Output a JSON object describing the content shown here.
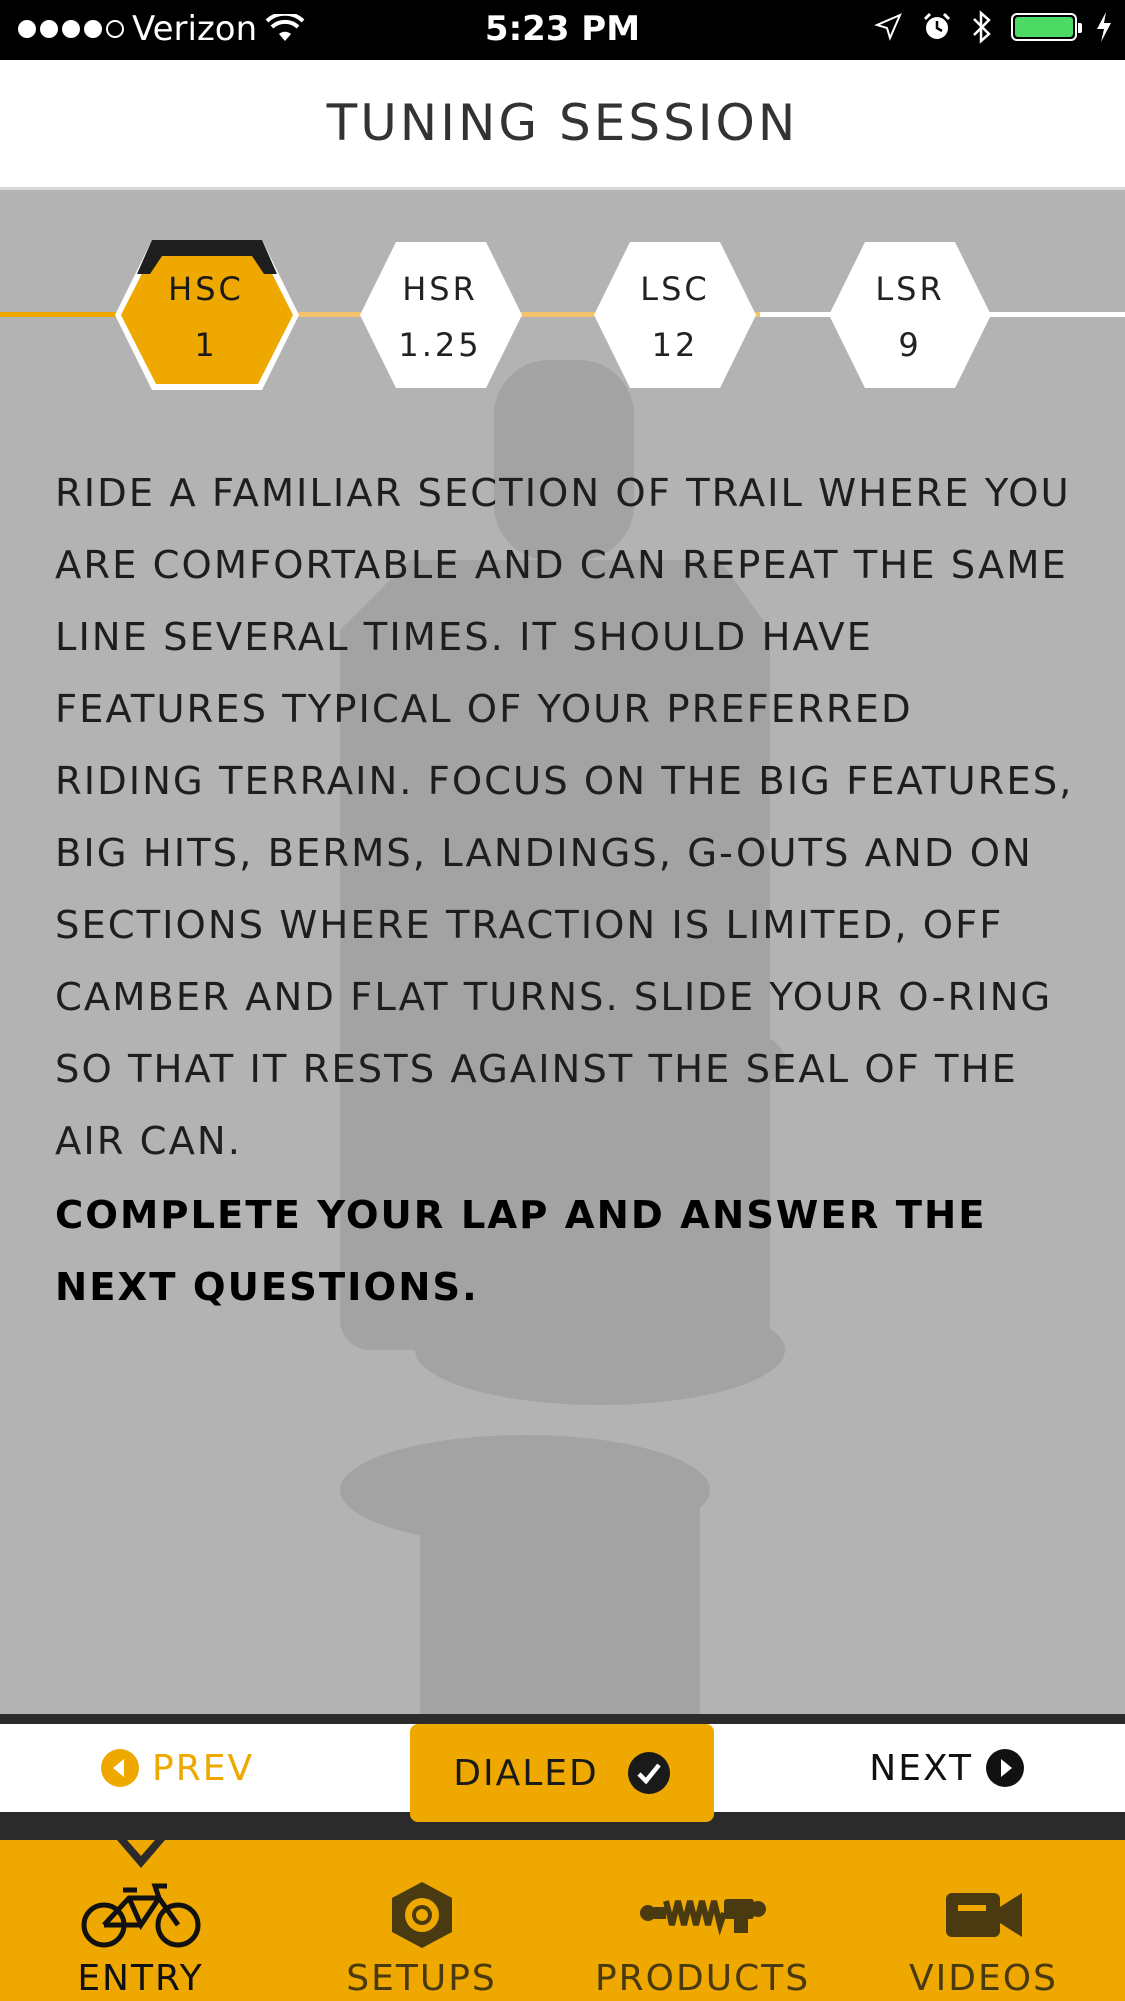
{
  "status_bar": {
    "carrier": "Verizon",
    "time": "5:23 PM"
  },
  "header": {
    "title": "TUNING SESSION"
  },
  "steps": [
    {
      "code": "HSC",
      "value": "1",
      "active": true
    },
    {
      "code": "HSR",
      "value": "1.25",
      "active": false
    },
    {
      "code": "LSC",
      "value": "12",
      "active": false
    },
    {
      "code": "LSR",
      "value": "9",
      "active": false
    }
  ],
  "instructions": {
    "body": "RIDE A FAMILIAR SECTION OF TRAIL WHERE YOU ARE COMFORTABLE AND CAN REPEAT THE SAME LINE SEVERAL TIMES. IT SHOULD HAVE FEATURES TYPICAL OF YOUR PREFERRED RIDING TERRAIN. FOCUS ON THE BIG FEATURES, BIG HITS, BERMS, LANDINGS, G-OUTS AND ON SECTIONS WHERE TRACTION IS LIMITED, OFF CAMBER AND FLAT TURNS. SLIDE YOUR O-RING SO THAT IT RESTS AGAINST THE SEAL OF THE AIR CAN.",
    "emphasis": "COMPLETE YOUR LAP AND ANSWER THE NEXT QUESTIONS."
  },
  "actions": {
    "prev_label": "PREV",
    "dialed_label": "DIALED",
    "next_label": "NEXT"
  },
  "tabs": [
    {
      "label": "ENTRY",
      "icon": "bike-icon",
      "active": true
    },
    {
      "label": "SETUPS",
      "icon": "hexagon-icon",
      "active": false
    },
    {
      "label": "PRODUCTS",
      "icon": "shock-icon",
      "active": false
    },
    {
      "label": "VIDEOS",
      "icon": "video-camera-icon",
      "active": false
    }
  ],
  "colors": {
    "accent": "#eea800",
    "background": "#b3b3b3",
    "dark": "#2b2b2b"
  }
}
